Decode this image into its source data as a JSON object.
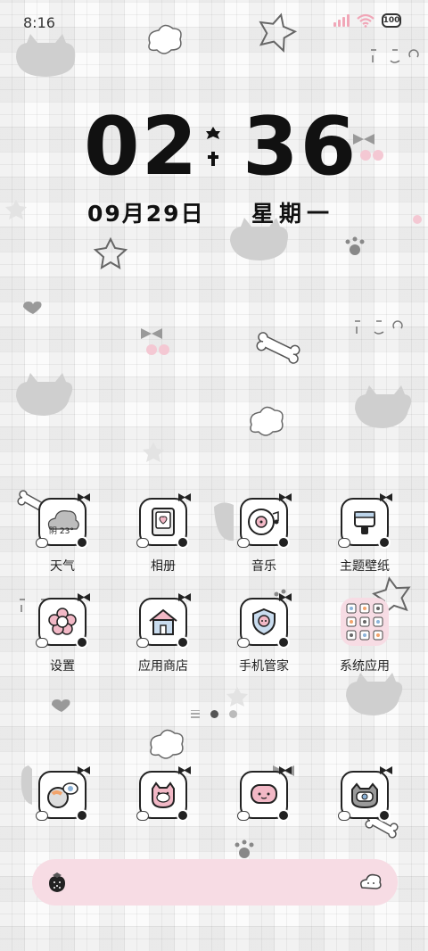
{
  "status_bar": {
    "time": "8:16",
    "battery": "100"
  },
  "clock": {
    "hours": "02",
    "minutes": "36",
    "date": "09月29日",
    "weekday": "星期一"
  },
  "apps": [
    {
      "label": "天气",
      "icon": "weather-icon",
      "temp": "阴 23°"
    },
    {
      "label": "相册",
      "icon": "gallery-icon"
    },
    {
      "label": "音乐",
      "icon": "music-icon"
    },
    {
      "label": "主题壁纸",
      "icon": "theme-icon"
    },
    {
      "label": "设置",
      "icon": "settings-icon"
    },
    {
      "label": "应用商店",
      "icon": "app-store-icon"
    },
    {
      "label": "手机管家",
      "icon": "security-icon"
    },
    {
      "label": "系统应用",
      "icon": "system-apps-folder-icon"
    }
  ],
  "dock": [
    {
      "icon": "phone-icon"
    },
    {
      "icon": "messages-icon"
    },
    {
      "icon": "browser-icon"
    },
    {
      "icon": "camera-icon"
    }
  ],
  "page_indicator": {
    "pages": 2,
    "active": 1
  },
  "colors": {
    "accent_pink": "#f7dce4",
    "icon_stroke": "#222222"
  }
}
